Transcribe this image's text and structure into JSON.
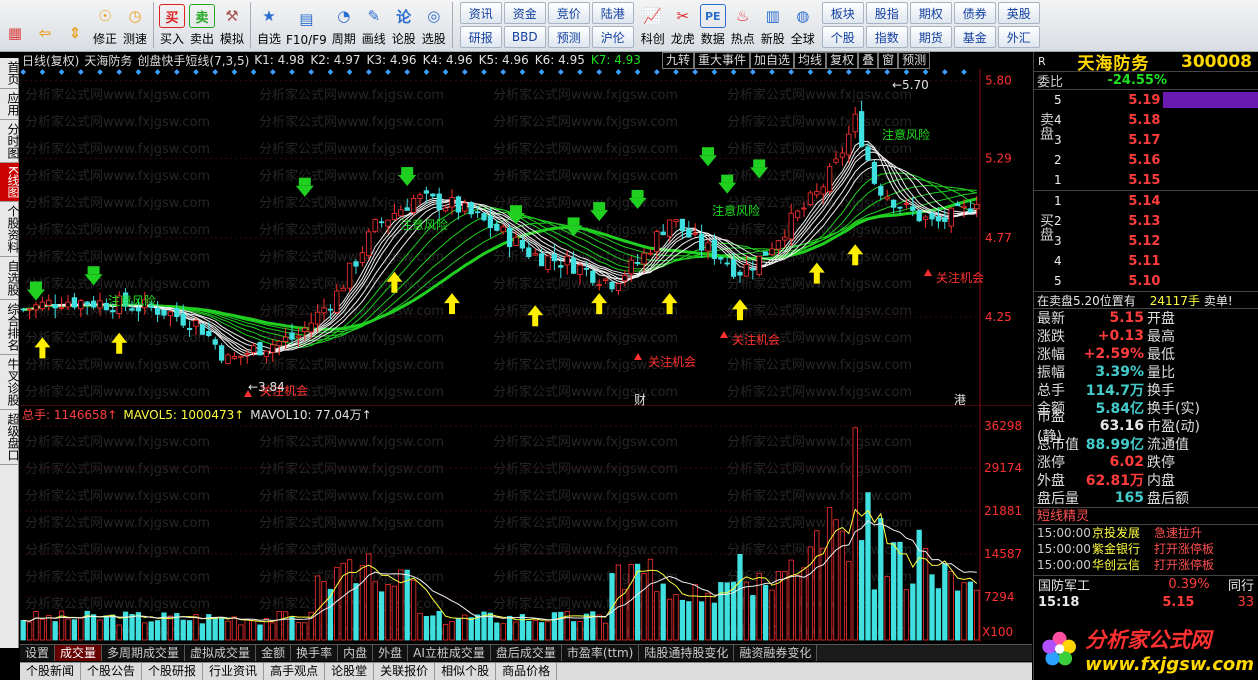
{
  "toolbar": {
    "left": [
      {
        "label": "",
        "icon": "grid-icon",
        "color": "#d44"
      },
      {
        "label": "",
        "icon": "back-arrow-icon",
        "color": "#e9a020"
      },
      {
        "label": "",
        "icon": "updown-icon",
        "color": "#e9a020"
      },
      {
        "label": "修正",
        "icon": "correct-icon",
        "color": "#e9a020"
      },
      {
        "label": "测速",
        "icon": "clock-icon",
        "color": "#e9a020"
      },
      {
        "label": "买入",
        "icon": "buy-icon",
        "color": "#d22",
        "glyph": "买"
      },
      {
        "label": "卖出",
        "icon": "sell-icon",
        "color": "#2a2",
        "glyph": "卖"
      },
      {
        "label": "模拟",
        "icon": "hammer-icon",
        "color": "#a55"
      },
      {
        "label": "自选",
        "icon": "star-icon",
        "color": "#2a6ed0"
      },
      {
        "label": "F10/F9",
        "icon": "f10-icon",
        "color": "#2a6ed0"
      },
      {
        "label": "周期",
        "icon": "period-icon",
        "color": "#2a6ed0"
      },
      {
        "label": "画线",
        "icon": "pen-icon",
        "color": "#2a6ed0"
      },
      {
        "label": "论股",
        "icon": "discuss-icon",
        "color": "#2a6ed0"
      },
      {
        "label": "选股",
        "icon": "select-icon",
        "color": "#2a6ed0"
      }
    ],
    "grid1": [
      "资讯",
      "资金",
      "竞价",
      "陆港",
      "研报",
      "BBD",
      "预测",
      "沪伦"
    ],
    "mid": [
      {
        "label": "科创",
        "icon": "chart-icon",
        "color": "#2a6ed0"
      },
      {
        "label": "龙虎",
        "icon": "dragon-icon",
        "color": "#d22"
      },
      {
        "label": "数据",
        "icon": "pe-icon",
        "color": "#2a6ed0",
        "glyph": "PE"
      },
      {
        "label": "热点",
        "icon": "fire-icon",
        "color": "#e23"
      },
      {
        "label": "新股",
        "icon": "ipo-icon",
        "color": "#2a6ed0"
      },
      {
        "label": "全球",
        "icon": "globe-icon",
        "color": "#2a6ed0"
      }
    ],
    "grid2": [
      "板块",
      "股指",
      "期权",
      "债券",
      "英股",
      "个股",
      "指数",
      "期货",
      "基金",
      "外汇"
    ]
  },
  "left_tabs": [
    {
      "label": "首页",
      "active": false
    },
    {
      "label": "应用",
      "active": false
    },
    {
      "label": "分时图",
      "active": false
    },
    {
      "label": "K线图",
      "active": true
    },
    {
      "label": "个股资料",
      "active": false
    },
    {
      "label": "自选股",
      "active": false
    },
    {
      "label": "综合排名",
      "active": false
    },
    {
      "label": "牛叉诊股",
      "active": false
    },
    {
      "label": "超级盘口",
      "active": false
    }
  ],
  "chart_header": {
    "period": "日线(复权)",
    "name": "天海防务",
    "indicator": "创盘快手短线(7,3,5)",
    "k_values": [
      {
        "label": "K1: 4.98",
        "color": "#e0e0e0"
      },
      {
        "label": "K2: 4.97",
        "color": "#e0e0e0"
      },
      {
        "label": "K3: 4.96",
        "color": "#e0e0e0"
      },
      {
        "label": "K4: 4.96",
        "color": "#e0e0e0"
      },
      {
        "label": "K5: 4.96",
        "color": "#e0e0e0"
      },
      {
        "label": "K6: 4.95",
        "color": "#e0e0e0"
      },
      {
        "label": "K7: 4.93",
        "color": "#20e020"
      }
    ],
    "buttons": [
      "九转",
      "重大事件",
      "加自选",
      "均线",
      "复权",
      "叠",
      "窗",
      "预测"
    ]
  },
  "watermark": "分析家公式网www.fxjgsw.com",
  "chart_data": [
    {
      "type": "candlestick",
      "ylim": [
        3.7,
        5.85
      ],
      "y_ticks": [
        "5.80",
        "5.29",
        "4.77",
        "4.25"
      ],
      "y_tick_values": [
        5.8,
        5.29,
        4.77,
        4.25
      ],
      "high_label": "5.70",
      "low_label": "3.84",
      "annotations": [
        {
          "text": "注意风险",
          "color": "#20e020"
        },
        {
          "text": "关注机会",
          "color": "#ff3030"
        },
        {
          "text": "财",
          "color": "#e0e0e0"
        },
        {
          "text": "港",
          "color": "#e0e0e0"
        }
      ]
    },
    {
      "type": "bar",
      "series_labels": [
        {
          "text": "总手: 1146658",
          "color": "#ff4040"
        },
        {
          "text": "MAVOL5: 1000473",
          "color": "#ffff40"
        },
        {
          "text": "MAVOL10: 77.04万",
          "color": "#e0e0e0"
        }
      ],
      "y_ticks": [
        "36298",
        "29174",
        "21881",
        "14587",
        "7294",
        "X100"
      ],
      "y_tick_values": [
        36298,
        29174,
        21881,
        14587,
        7294
      ]
    }
  ],
  "bottom_tabs": [
    "设置",
    "成交量",
    "多周期成交量",
    "虚拟成交量",
    "金额",
    "换手率",
    "内盘",
    "外盘",
    "AI立桩成交量",
    "盘后成交量",
    "市盈率(ttm)",
    "陆股通持股变化",
    "融资融券变化"
  ],
  "active_bottom_tab": "成交量",
  "news_tabs": [
    "个股新闻",
    "个股公告",
    "个股研报",
    "行业资讯",
    "高手观点",
    "论股堂",
    "关联报价",
    "相似个股",
    "商品价格"
  ],
  "right": {
    "marker": "R",
    "stock_name": "天海防务",
    "stock_code": "300008",
    "weibi_label": "委比",
    "weibi_value": "-24.55%",
    "sell_label": "卖盘",
    "buy_label": "买盘",
    "sell": [
      {
        "lvl": "5",
        "price": "5.19"
      },
      {
        "lvl": "4",
        "price": "5.18"
      },
      {
        "lvl": "3",
        "price": "5.17"
      },
      {
        "lvl": "2",
        "price": "5.16"
      },
      {
        "lvl": "1",
        "price": "5.15"
      }
    ],
    "buy": [
      {
        "lvl": "1",
        "price": "5.14"
      },
      {
        "lvl": "2",
        "price": "5.13"
      },
      {
        "lvl": "3",
        "price": "5.12"
      },
      {
        "lvl": "4",
        "price": "5.11"
      },
      {
        "lvl": "5",
        "price": "5.10"
      }
    ],
    "notice": {
      "text": "在卖盘5.20位置有",
      "vol": "24117手",
      "suffix": "卖单!"
    },
    "quotes": [
      {
        "k1": "最新",
        "v1": "5.15",
        "c1": "red",
        "k2": "开盘"
      },
      {
        "k1": "涨跌",
        "v1": "+0.13",
        "c1": "red",
        "k2": "最高"
      },
      {
        "k1": "涨幅",
        "v1": "+2.59%",
        "c1": "red",
        "k2": "最低"
      },
      {
        "k1": "振幅",
        "v1": "3.39%",
        "c1": "cyan",
        "k2": "量比"
      },
      {
        "k1": "总手",
        "v1": "114.7万",
        "c1": "cyan",
        "k2": "换手"
      },
      {
        "k1": "金额",
        "v1": "5.84亿",
        "c1": "cyan",
        "k2": "换手(实)"
      },
      {
        "k1": "市盈(静)",
        "v1": "63.16",
        "c1": "white",
        "k2": "市盈(动)"
      },
      {
        "k1": "总市值",
        "v1": "88.99亿",
        "c1": "cyan",
        "k2": "流通值"
      },
      {
        "k1": "涨停",
        "v1": "6.02",
        "c1": "red",
        "k2": "跌停"
      },
      {
        "k1": "外盘",
        "v1": "62.81万",
        "c1": "red",
        "k2": "内盘"
      },
      {
        "k1": "盘后量",
        "v1": "165",
        "c1": "cyan",
        "k2": "盘后额"
      }
    ],
    "alerts_title": "短线精灵",
    "alerts": [
      {
        "t": "15:00:00",
        "n": "京投发展",
        "e": "急速拉升"
      },
      {
        "t": "15:00:00",
        "n": "紫金银行",
        "e": "打开涨停板"
      },
      {
        "t": "15:00:00",
        "n": "华创云信",
        "e": "打开涨停板"
      }
    ],
    "sector": {
      "name": "国防军工",
      "pct": "0.39%",
      "extra": "同行"
    },
    "tick": {
      "time": "15:18",
      "price": "5.15",
      "vol": "33"
    }
  },
  "logo": {
    "title": "分析家公式网",
    "url": "www.fxjgsw.com"
  }
}
